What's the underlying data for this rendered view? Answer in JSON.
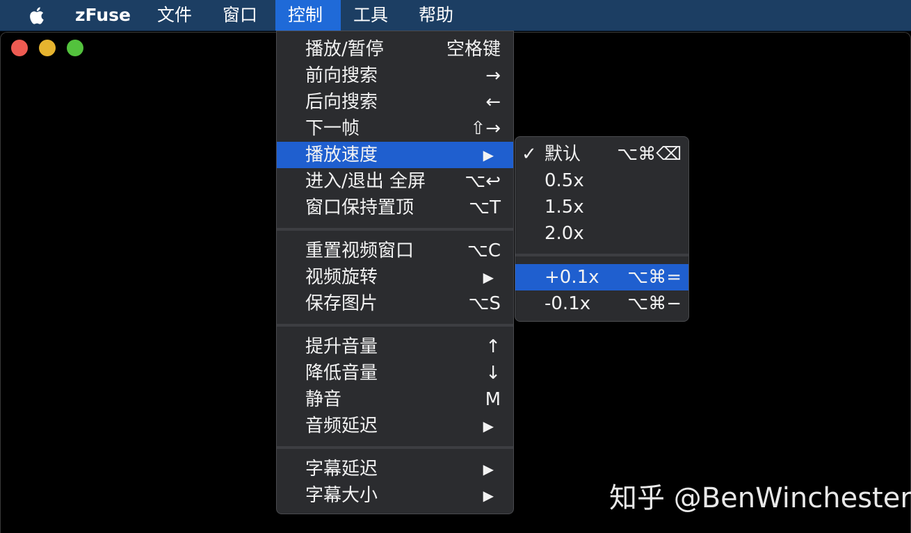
{
  "menubar": {
    "app_name": "zFuse",
    "items": [
      "文件",
      "窗口",
      "控制",
      "工具",
      "帮助"
    ]
  },
  "colors": {
    "menubar_bg": "#1c3e63",
    "highlight": "#1f5fcf",
    "close": "#ee5b52",
    "minimize": "#e6b42f",
    "zoom": "#53c23d"
  },
  "control_menu": {
    "items": [
      {
        "label": "播放/暂停",
        "shortcut": "空格键"
      },
      {
        "label": "前向搜索",
        "shortcut": "→"
      },
      {
        "label": "后向搜索",
        "shortcut": "←"
      },
      {
        "label": "下一帧",
        "shortcut": "⇧→"
      },
      {
        "label": "播放速度",
        "shortcut": "▶"
      },
      {
        "label": "进入/退出 全屏",
        "shortcut": "⌥↩"
      },
      {
        "label": "窗口保持置顶",
        "shortcut": "⌥T"
      },
      {
        "label": "重置视频窗口",
        "shortcut": "⌥C"
      },
      {
        "label": "视频旋转",
        "shortcut": "▶"
      },
      {
        "label": "保存图片",
        "shortcut": "⌥S"
      },
      {
        "label": "提升音量",
        "shortcut": "↑"
      },
      {
        "label": "降低音量",
        "shortcut": "↓"
      },
      {
        "label": "静音",
        "shortcut": "M"
      },
      {
        "label": "音频延迟",
        "shortcut": "▶"
      },
      {
        "label": "字幕延迟",
        "shortcut": "▶"
      },
      {
        "label": "字幕大小",
        "shortcut": "▶"
      }
    ]
  },
  "speed_menu": {
    "check_mark": "✓",
    "items": [
      {
        "label": "默认",
        "shortcut": "⌥⌘⌫"
      },
      {
        "label": "0.5x",
        "shortcut": ""
      },
      {
        "label": "1.5x",
        "shortcut": ""
      },
      {
        "label": "2.0x",
        "shortcut": ""
      },
      {
        "label": "+0.1x",
        "shortcut": "⌥⌘="
      },
      {
        "label": "-0.1x",
        "shortcut": "⌥⌘−"
      }
    ]
  },
  "watermark": "知乎 @BenWinchester"
}
